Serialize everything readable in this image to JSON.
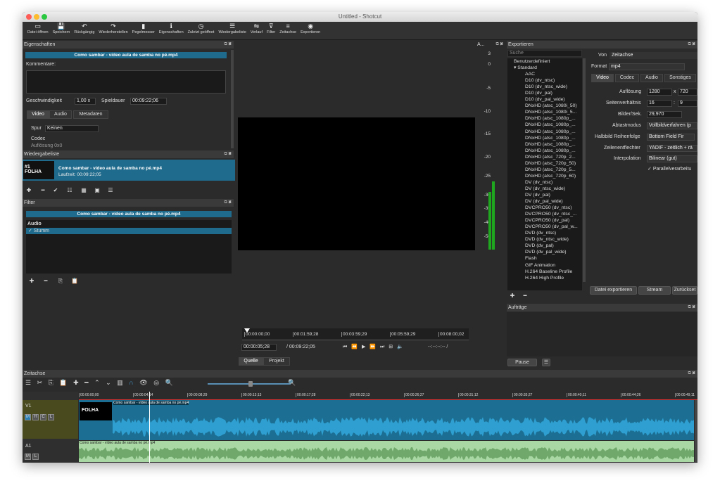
{
  "window": {
    "title": "Untitled - Shotcut"
  },
  "toolbar": [
    {
      "icon": "▭",
      "label": "Datei öffnen",
      "name": "open-file"
    },
    {
      "icon": "💾",
      "label": "Speichern",
      "name": "save"
    },
    {
      "icon": "↶",
      "label": "Rückgängig",
      "name": "undo"
    },
    {
      "icon": "↷",
      "label": "Wiederherstellen",
      "name": "redo"
    },
    {
      "icon": "▮",
      "label": "Pegelmesser",
      "name": "peak-meter"
    },
    {
      "icon": "ℹ",
      "label": "Eigenschaften",
      "name": "properties"
    },
    {
      "icon": "◷",
      "label": "Zuletzt geöffnet",
      "name": "recent"
    },
    {
      "icon": "☰",
      "label": "Wiedergabeliste",
      "name": "playlist"
    },
    {
      "icon": "⇋",
      "label": "Verlauf",
      "name": "history"
    },
    {
      "icon": "⊽",
      "label": "Filter",
      "name": "filter"
    },
    {
      "icon": "≡",
      "label": "Zeitachse",
      "name": "timeline"
    },
    {
      "icon": "◉",
      "label": "Exportieren",
      "name": "export"
    }
  ],
  "properties": {
    "title": "Eigenschaften",
    "clip": "Como sambar - vídeo aula de samba no pé.mp4",
    "comments_label": "Kommentare:",
    "speed_label": "Geschwindigkeit",
    "speed": "1,00 x",
    "duration_label": "Spieldauer",
    "duration": "00:09:22;06",
    "tabs": [
      "Video",
      "Audio",
      "Metadaten"
    ],
    "track_label": "Spur",
    "track": "Keinen",
    "codec": "Codec",
    "cut": "Auflösung    0x0"
  },
  "playlist": {
    "title": "Wiedergabeliste",
    "num": "#1",
    "thumb": "FOLHA",
    "clip": "Como sambar - vídeo aula de samba no pé.mp4",
    "runtime": "Laufzeit: 00:09:22;05"
  },
  "filter": {
    "title": "Filter",
    "clip": "Como sambar - vídeo aula de samba no pé.mp4",
    "group": "Audio",
    "item": "Stumm",
    "check": "✓"
  },
  "meter": {
    "title": "A...",
    "scale": [
      "3",
      "0",
      "-5",
      "-10",
      "-15",
      "-20",
      "-25",
      "-30",
      "-35",
      "-40",
      "-50"
    ]
  },
  "player": {
    "ticks": [
      "00:00:00;00",
      "00:01:59;28",
      "00:03:59;29",
      "00:05:59;29",
      "00:08:00;02"
    ],
    "position": "00:00:05;28",
    "total": "/ 00:09:22;05",
    "inout": "--:--:--:-- /",
    "tabs": [
      "Quelle",
      "Projekt"
    ]
  },
  "export": {
    "title": "Exportieren",
    "search": "Suche",
    "presets": [
      "Benutzerdefiniert",
      "▾ Standard",
      "AAC",
      "D10 (dv_ntsc)",
      "D10 (dv_ntsc_wide)",
      "D10 (dv_pal)",
      "D10 (dv_pal_wide)",
      "DNxHD (atsc_1080i_50)",
      "DNxHD (atsc_1080i_5...",
      "DNxHD (atsc_1080p_...",
      "DNxHD (atsc_1080p_...",
      "DNxHD (atsc_1080p_...",
      "DNxHD (atsc_1080p_...",
      "DNxHD (atsc_1080p_...",
      "DNxHD (atsc_1080p_...",
      "DNxHD (atsc_720p_2...",
      "DNxHD (atsc_720p_50)",
      "DNxHD (atsc_720p_5...",
      "DNxHD (atsc_720p_60)",
      "DV (dv_ntsc)",
      "DV (dv_ntsc_wide)",
      "DV (dv_pal)",
      "DV (dv_pal_wide)",
      "DVCPRO50 (dv_ntsc)",
      "DVCPRO50 (dv_ntsc_...",
      "DVCPRO50 (dv_pal)",
      "DVCPRO50 (dv_pal_w...",
      "DVD (dv_ntsc)",
      "DVD (dv_ntsc_wide)",
      "DVD (dv_pal)",
      "DVD (dv_pal_wide)",
      "Flash",
      "GIF Animation",
      "H.264 Baseline Profile",
      "H.264 High Profile"
    ],
    "von_label": "Von",
    "von": "Zeitachse",
    "format_label": "Format",
    "format": "mp4",
    "tabs": [
      "Video",
      "Codec",
      "Audio",
      "Sonstiges"
    ],
    "res_label": "Auflösung",
    "res_w": "1280",
    "res_x": "x",
    "res_h": "720",
    "aspect_label": "Seitenverhältnis",
    "aspect_w": "16",
    "aspect_sep": ":",
    "aspect_h": "9",
    "fps_label": "Bilder/Sek.",
    "fps": "29,970",
    "scan_label": "Abtastmodus",
    "scan": "Vollbildverfahren (p",
    "field_label": "Halbbild Reihenfolge",
    "field": "Bottom Field Fir",
    "deint_label": "Zeilenentflechter",
    "deint": "YADIF - zeitlich + rä",
    "interp_label": "Interpolation",
    "interp": "Bilinear (gut)",
    "parallel": "Parallelverarbeitu",
    "export_btn": "Datei exportieren",
    "stream_btn": "Stream",
    "reset_btn": "Zurückset"
  },
  "jobs": {
    "title": "Aufträge",
    "pause": "Pause",
    "menu": "☰"
  },
  "timeline": {
    "title": "Zeitachse",
    "ticks": [
      "00:00:00;00",
      "00:00:04;14",
      "00:00:08;29",
      "00:00:13;13",
      "00:00:17;28",
      "00:00:22;13",
      "00:00:26;27",
      "00:00:31;12",
      "00:00:35;27",
      "00:00:40;11",
      "00:00:44;26",
      "00:00:49;11"
    ],
    "v1": "V1",
    "a1": "A1",
    "v_clip": "Como sambar - vídeo aula de samba no pé.mp4",
    "a_clip": "Como sambar - vídeo aula de samba no pé.mp4",
    "thumb": "FOLHA",
    "v_btns": [
      "M",
      "H",
      "C",
      "L"
    ],
    "a_btns": [
      "M",
      "L"
    ]
  },
  "colors": {
    "accent": "#1f6b8d",
    "meter": "#22b422",
    "video_track": "#1c6f93",
    "audio_track": "#a9d8a4"
  }
}
